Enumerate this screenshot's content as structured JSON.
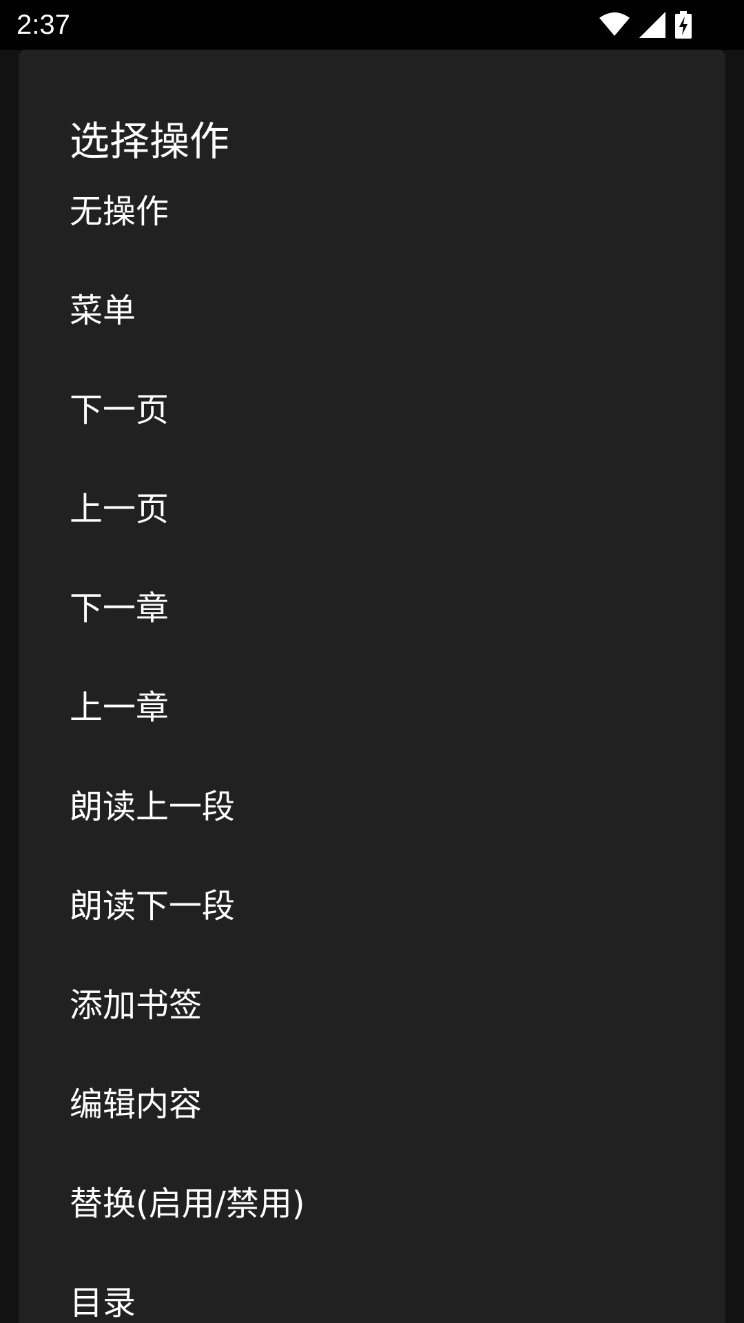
{
  "status_bar": {
    "time": "2:37",
    "icons": [
      "wifi-icon",
      "signal-icon",
      "battery-charging-icon"
    ]
  },
  "dialog": {
    "title": "选择操作",
    "options": [
      {
        "label": "无操作"
      },
      {
        "label": "菜单"
      },
      {
        "label": "下一页"
      },
      {
        "label": "上一页"
      },
      {
        "label": "下一章"
      },
      {
        "label": "上一章"
      },
      {
        "label": "朗读上一段"
      },
      {
        "label": "朗读下一段"
      },
      {
        "label": "添加书签"
      },
      {
        "label": "编辑内容"
      },
      {
        "label": "替换(启用/禁用)"
      },
      {
        "label": "目录"
      }
    ]
  },
  "colors": {
    "dialog_background": "#212121",
    "status_bar_background": "#000000",
    "text": "#ffffff"
  }
}
